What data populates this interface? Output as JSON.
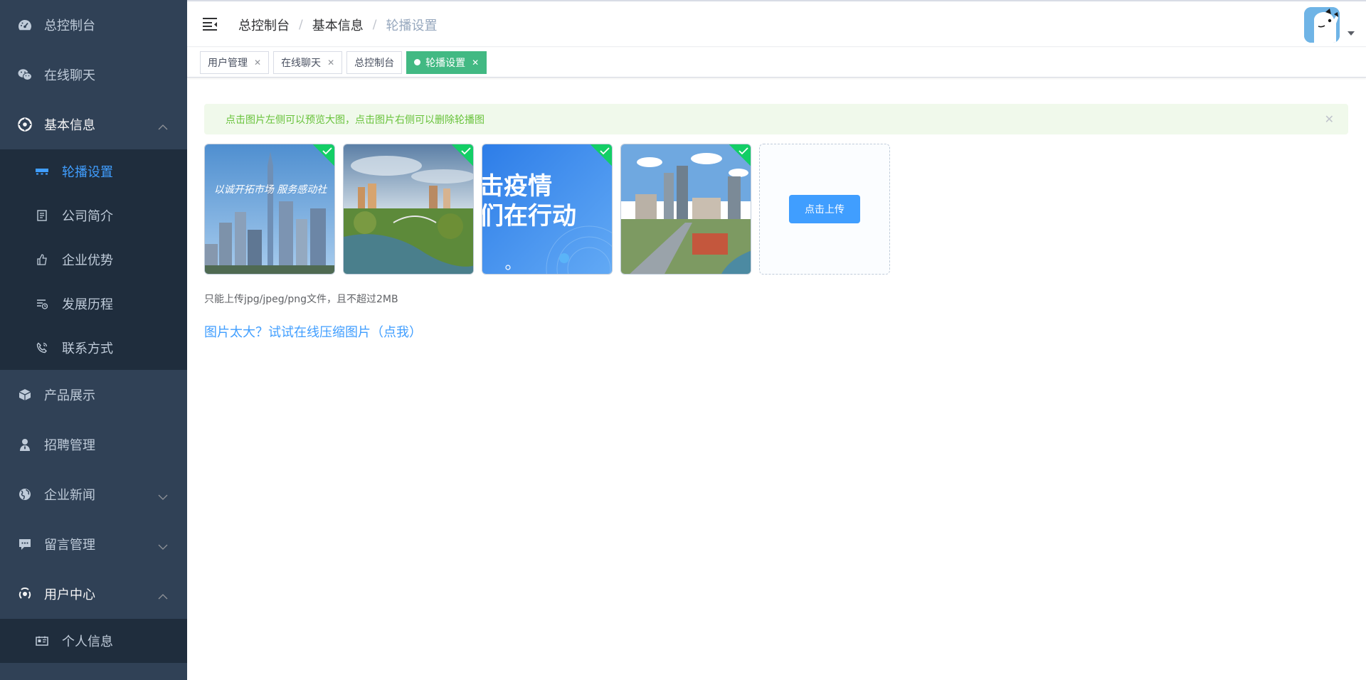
{
  "sidebar": {
    "items": [
      {
        "label": "总控制台",
        "icon": "dashboard-icon"
      },
      {
        "label": "在线聊天",
        "icon": "wechat-icon"
      },
      {
        "label": "基本信息",
        "icon": "info-icon",
        "open": true
      },
      {
        "label": "产品展示",
        "icon": "box-icon"
      },
      {
        "label": "招聘管理",
        "icon": "user-tie-icon"
      },
      {
        "label": "企业新闻",
        "icon": "globe-icon"
      },
      {
        "label": "留言管理",
        "icon": "message-icon"
      },
      {
        "label": "用户中心",
        "icon": "user-center-icon",
        "open": true
      }
    ],
    "basic_info_children": [
      {
        "label": "轮播设置",
        "icon": "carousel-icon",
        "active": true
      },
      {
        "label": "公司简介",
        "icon": "document-icon"
      },
      {
        "label": "企业优势",
        "icon": "thumbs-up-icon"
      },
      {
        "label": "发展历程",
        "icon": "history-icon"
      },
      {
        "label": "联系方式",
        "icon": "phone-icon"
      }
    ],
    "user_center_children": [
      {
        "label": "个人信息",
        "icon": "id-card-icon"
      }
    ]
  },
  "breadcrumb": [
    "总控制台",
    "基本信息",
    "轮播设置"
  ],
  "tags": [
    {
      "label": "用户管理",
      "closable": true
    },
    {
      "label": "在线聊天",
      "closable": true
    },
    {
      "label": "总控制台",
      "closable": false
    },
    {
      "label": "轮播设置",
      "closable": true,
      "active": true
    }
  ],
  "alert": {
    "text": "点击图片左侧可以预览大图，点击图片右侧可以删除轮播图"
  },
  "carousel_images": [
    {
      "overlay_text": "以诚开拓市场 服务感动社"
    },
    {
      "overlay_text": ""
    },
    {
      "overlay_text_line1": "击疫情",
      "overlay_text_line2": "们在行动"
    },
    {
      "overlay_text": ""
    }
  ],
  "upload": {
    "button_label": "点击上传",
    "tip": "只能上传jpg/jpeg/png文件，且不超过2MB",
    "compress_link": "图片太大？试试在线压缩图片（点我）"
  },
  "colors": {
    "sidebar_bg": "#304156",
    "submenu_bg": "#1f2d3d",
    "active_link": "#409eff",
    "tag_active": "#42b983",
    "success_check": "#13ce66",
    "alert_bg": "#f0f9eb",
    "alert_text": "#67c23a"
  }
}
